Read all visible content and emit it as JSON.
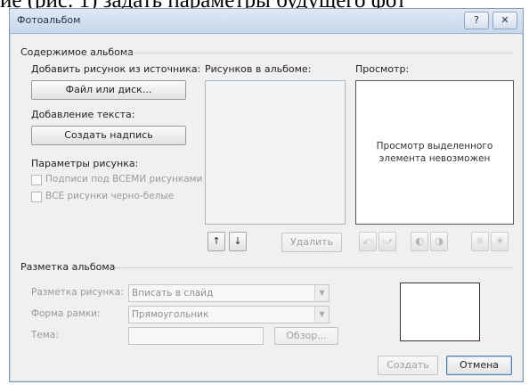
{
  "document": {
    "text_fragment": "ие (рис. 1) задать параметры будущего фот"
  },
  "dialog": {
    "title": "Фотоальбом",
    "help_glyph": "?",
    "close_glyph": "✕"
  },
  "album_content": {
    "section_title": "Содержимое альбома",
    "add_picture_from_label": "Добавить рисунок из источника:",
    "file_or_disk_button": "Файл или диск...",
    "add_text_label": "Добавление текста:",
    "create_caption_button": "Создать надпись",
    "picture_options_label": "Параметры рисунка:",
    "captions_below_all_label": "Подписи под ВСЕМИ рисунками",
    "all_black_white_label": "ВСЕ рисунки черно-белые",
    "pictures_in_album_label": "Рисунков в альбоме:",
    "move_up_glyph": "↑",
    "move_down_glyph": "↓",
    "remove_button": "Удалить",
    "preview_label": "Просмотр:",
    "preview_message_line1": "Просмотр выделенного",
    "preview_message_line2": "элемента невозможен",
    "tool_icons": [
      "rotate-left-icon",
      "rotate-right-icon",
      "contrast-up-icon",
      "contrast-down-icon",
      "brightness-up-icon",
      "brightness-down-icon"
    ],
    "tool_glyphs": [
      "⤺",
      "⤻",
      "◐",
      "◑",
      "☼",
      "☀"
    ]
  },
  "album_layout": {
    "section_title": "Разметка альбома",
    "picture_layout_label": "Разметка рисунка:",
    "picture_layout_value": "Вписать в слайд",
    "frame_shape_label": "Форма рамки:",
    "frame_shape_value": "Прямоугольник",
    "theme_label": "Тема:",
    "theme_value": "",
    "browse_button": "Обзор..."
  },
  "footer": {
    "create_button": "Создать",
    "cancel_button": "Отмена"
  }
}
